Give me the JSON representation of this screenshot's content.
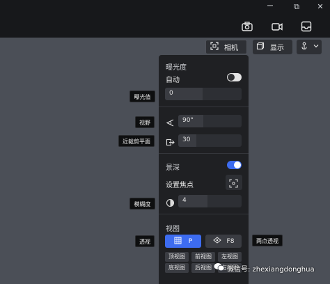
{
  "window": {
    "restore_glyph": "⧉",
    "close_glyph": "✕"
  },
  "toolbar": {
    "icons": [
      "camera-icon",
      "video-icon",
      "inbox-icon"
    ]
  },
  "viewbar": {
    "camera_label": "相机",
    "display_label": "显示"
  },
  "panel": {
    "exposure": {
      "title": "曝光度",
      "auto_label": "自动",
      "auto_on": false,
      "value": "0"
    },
    "fov": {
      "value": "90°"
    },
    "clip": {
      "value": "30"
    },
    "dof": {
      "title": "景深",
      "enabled": true,
      "focus_label": "设置焦点",
      "blur_value": "4"
    },
    "view": {
      "title": "视图",
      "perspective_label": "P",
      "ortho_label": "F8",
      "buttons": [
        "顶视图",
        "前视图",
        "左视图",
        "底视图",
        "后视图",
        "右视图"
      ]
    }
  },
  "tooltips": {
    "exposure_value": "曝光值",
    "fov": "视野",
    "near_clip": "近裁剪平面",
    "blur": "模糊度",
    "perspective": "透视",
    "ortho": "两点透视"
  },
  "watermark": {
    "text": "微信号: zhexiangdonghua"
  },
  "colors": {
    "accent": "#3d6cf0",
    "panel": "#1f2023",
    "background": "#4b4f57"
  }
}
